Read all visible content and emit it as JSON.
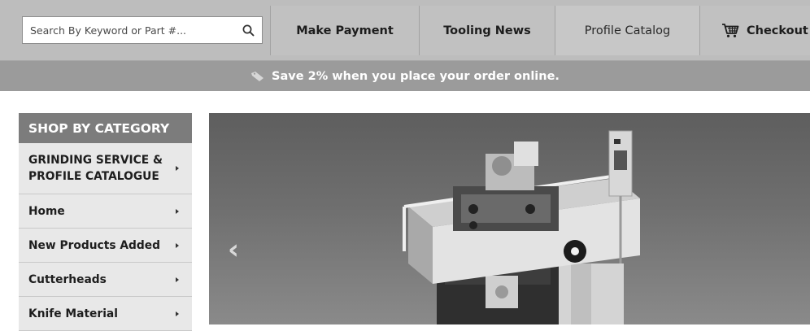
{
  "search": {
    "placeholder": "Search By Keyword or Part #..."
  },
  "nav": {
    "items": [
      {
        "label": "Make Payment"
      },
      {
        "label": "Tooling News"
      },
      {
        "label": "Profile Catalog"
      },
      {
        "label": "Checkout",
        "icon": "cart-icon"
      }
    ]
  },
  "promo": {
    "text": "Save 2% when you place your order online.",
    "icon": "tag-icon"
  },
  "sidebar": {
    "title": "SHOP BY CATEGORY",
    "items": [
      {
        "label_line1": "GRINDING SERVICE &",
        "label_line2": "PROFILE CATALOGUE"
      },
      {
        "label": "Home"
      },
      {
        "label": "New Products Added"
      },
      {
        "label": "Cutterheads"
      },
      {
        "label": "Knife Material"
      }
    ]
  },
  "hero": {
    "prev_icon": "chevron-left-icon",
    "prev_glyph": "‹",
    "image": "grinding-machine"
  },
  "colors": {
    "topbar": "#bdbdbd",
    "promo": "#9b9b9b",
    "sidebar_head": "#7c7c7c",
    "sidebar_item": "#e8e8e8"
  }
}
